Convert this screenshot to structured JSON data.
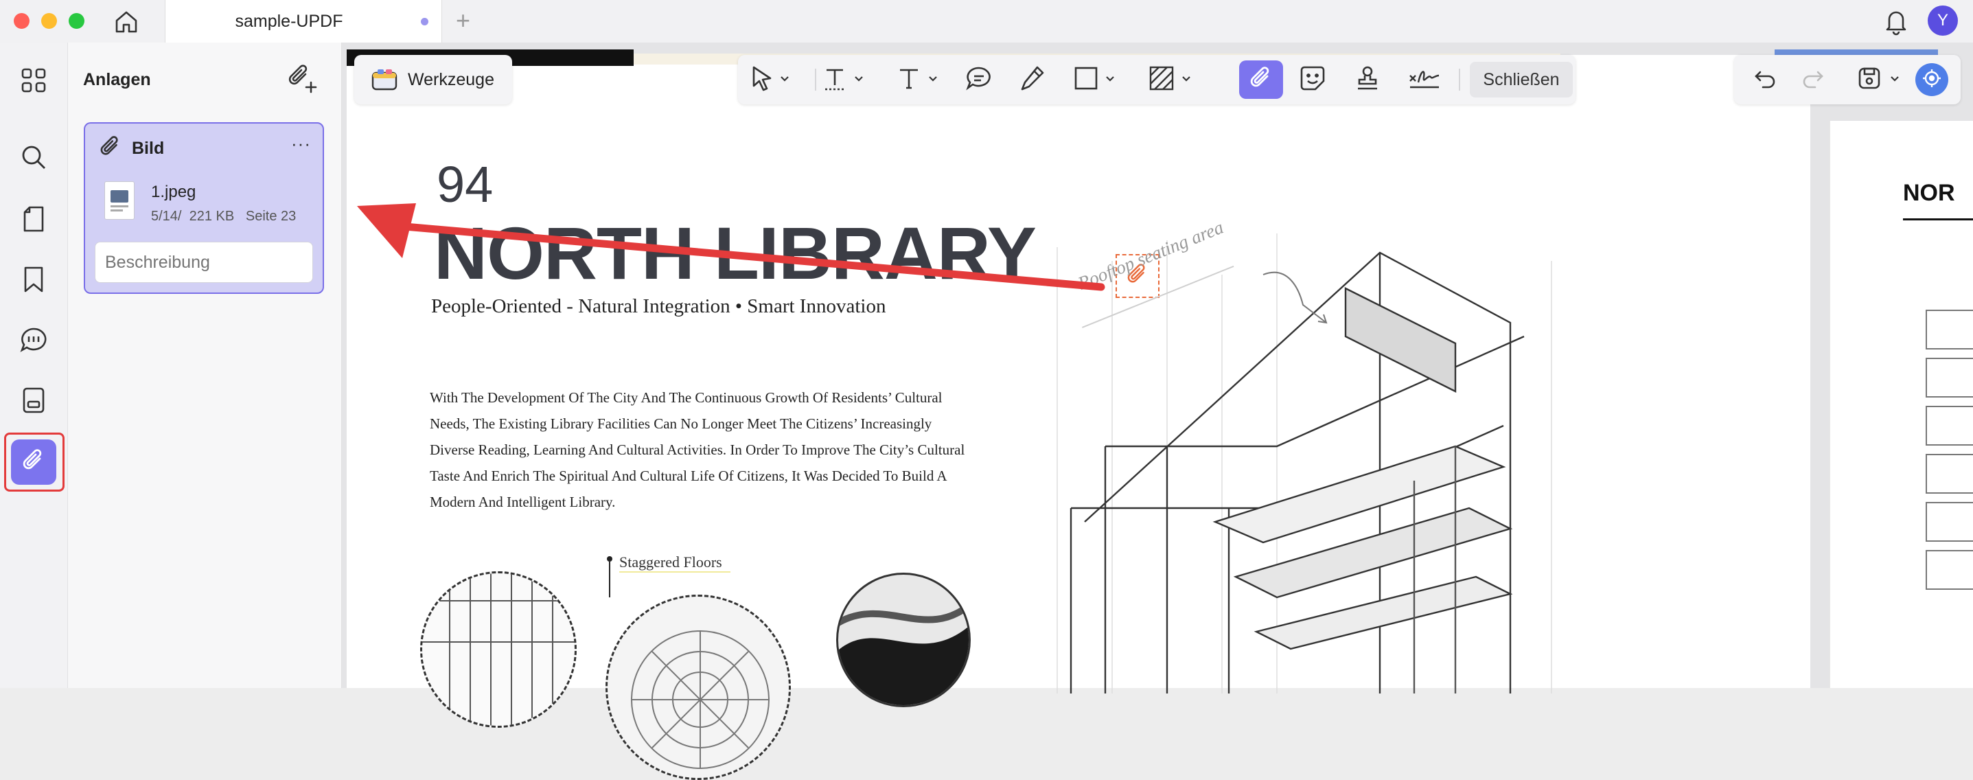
{
  "window": {
    "tab_title": "sample-UPDF",
    "user_initial": "Y"
  },
  "rail": {
    "items": [
      "thumbnails",
      "search",
      "pages",
      "bookmarks",
      "comments",
      "forms",
      "attachments"
    ]
  },
  "panel": {
    "title": "Anlagen",
    "card": {
      "title": "Bild",
      "more": "···",
      "file_name": "1.jpeg",
      "file_meta": "5/14/  221 KB   Seite 23",
      "description_placeholder": "Beschreibung"
    }
  },
  "toolbar": {
    "werkzeuge_label": "Werkzeuge",
    "close_label": "Schließen"
  },
  "document": {
    "page_number": "94",
    "title": "NORTH LIBRARY",
    "subtitle": "People-Oriented - Natural Integration • Smart Innovation",
    "body": "With The Development Of The City And The Continuous Growth Of Residents’ Cultural Needs, The Existing Library Facilities Can No Longer Meet The Citizens’ Increasingly Diverse Reading, Learning And Cultural Activities. In Order To Improve The City’s Cultural Taste And Enrich The Spiritual And Cultural Life Of Citizens, It Was Decided To Build A Modern And Intelligent Library.",
    "staggered_label": "Staggered Floors",
    "rooftop_label": "Rooftop seating area",
    "next_page_heading": "NOR"
  },
  "colors": {
    "accent": "#7c74ee",
    "highlight_red": "#e33b3b",
    "card_bg": "#d2d0f5"
  }
}
